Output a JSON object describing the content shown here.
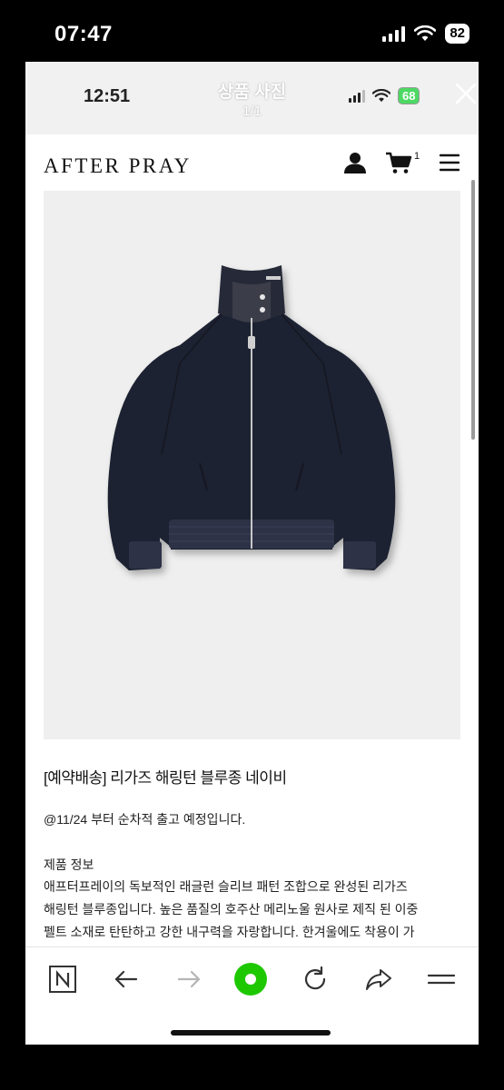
{
  "outer_status": {
    "time": "07:47",
    "battery": "82"
  },
  "viewer": {
    "inner_time": "12:51",
    "title": "상품 사진",
    "counter": "1/1",
    "inner_battery": "68"
  },
  "store": {
    "logo": "AFTER PRAY",
    "cart_count": "1",
    "product_title": "[예약배송] 리가즈 해링턴 블루종 네이비",
    "ship_note": "@11/24 부터 순차적 출고 예정입니다.",
    "info_heading": "제품 정보",
    "description_lines": [
      "애프터프레이의 독보적인 래글런 슬리브 패턴 조합으로 완성된 리가즈",
      "해링턴 블루종입니다. 높은 품질의 호주산 메리노울 원사로 제직 된 이중",
      "펠트 소재로 탄탄하고 강한 내구력을 자랑합니다. 한겨울에도 착용이 가"
    ]
  },
  "colors": {
    "accent_green": "#1ec800",
    "jacket_navy": "#1f2230",
    "image_bg": "#efefef"
  },
  "icons": [
    "user-icon",
    "cart-icon",
    "menu-icon",
    "n-icon",
    "back-arrow-icon",
    "forward-arrow-icon",
    "green-dot-icon",
    "reload-icon",
    "share-icon",
    "hamburger-icon",
    "close-icon"
  ]
}
